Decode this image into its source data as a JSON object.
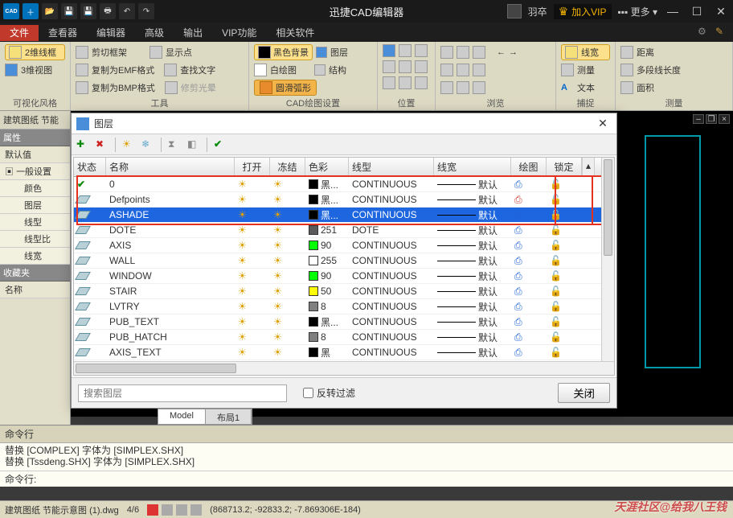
{
  "app": {
    "title": "迅捷CAD编辑器"
  },
  "titlebar": {
    "user_name": "羽卒",
    "vip_label": "加入VIP",
    "more_label": "更多"
  },
  "menubar": {
    "items": [
      "文件",
      "查看器",
      "编辑器",
      "高级",
      "输出",
      "VIP功能",
      "相关软件"
    ],
    "active_index": 0
  },
  "ribbon": {
    "group_visual": {
      "btn_2d": "2维线框",
      "btn_3d": "3维视图",
      "label": "可视化风格"
    },
    "group_tools": {
      "cut_frame": "剪切框架",
      "copy_emf": "复制为EMF格式",
      "copy_bmp": "复制为BMP格式",
      "show_point": "显示点",
      "find_text": "查找文字",
      "trim_light": "修剪光晕",
      "label": "工具"
    },
    "group_cad": {
      "black_bg": "黑色背景",
      "white_draw": "白绘图",
      "arc": "圆滑弧形",
      "layers": "图层",
      "structure": "结构",
      "label": "CAD绘图设置"
    },
    "group_position": {
      "label": "位置"
    },
    "group_browse": {
      "label": "浏览"
    },
    "group_measure": {
      "linewidth": "线宽",
      "measure": "测量",
      "text": "文本",
      "distance": "距离",
      "polyline_length": "多段线长度",
      "area": "面积",
      "ext": "捕捉",
      "label": "测量"
    }
  },
  "left_panel": {
    "tab1": "建筑图纸 节能",
    "prop_header": "属性",
    "default": "默认值",
    "general": "一般设置",
    "rows": [
      "颜色",
      "图层",
      "线型",
      "线型比",
      "线宽"
    ],
    "fav_header": "收藏夹",
    "name_header": "名称"
  },
  "dialog": {
    "title": "图层",
    "columns": {
      "state": "状态",
      "name": "名称",
      "open": "打开",
      "freeze": "冻结",
      "color": "色彩",
      "ltype": "线型",
      "lw": "线宽",
      "plot": "绘图",
      "lock": "锁定"
    },
    "layers": [
      {
        "name": "0",
        "current": true,
        "color_label": "黑...",
        "swatch": "#000000",
        "ltype": "CONTINUOUS",
        "lw": "默认",
        "plot": true,
        "selected": false
      },
      {
        "name": "Defpoints",
        "current": false,
        "color_label": "黑...",
        "swatch": "#000000",
        "ltype": "CONTINUOUS",
        "lw": "默认",
        "plot": false,
        "selected": false
      },
      {
        "name": "ASHADE",
        "current": false,
        "color_label": "黑...",
        "swatch": "#000000",
        "ltype": "CONTINUOUS",
        "lw": "默认",
        "plot": true,
        "selected": true
      },
      {
        "name": "DOTE",
        "current": false,
        "color_label": "251",
        "swatch": "#5b5b5b",
        "ltype": "DOTE",
        "lw": "默认",
        "plot": true,
        "selected": false
      },
      {
        "name": "AXIS",
        "current": false,
        "color_label": "90",
        "swatch": "#00ff00",
        "ltype": "CONTINUOUS",
        "lw": "默认",
        "plot": true,
        "selected": false
      },
      {
        "name": "WALL",
        "current": false,
        "color_label": "255",
        "swatch": "#ffffff",
        "ltype": "CONTINUOUS",
        "lw": "默认",
        "plot": true,
        "selected": false
      },
      {
        "name": "WINDOW",
        "current": false,
        "color_label": "90",
        "swatch": "#00ff00",
        "ltype": "CONTINUOUS",
        "lw": "默认",
        "plot": true,
        "selected": false
      },
      {
        "name": "STAIR",
        "current": false,
        "color_label": "50",
        "swatch": "#ffff00",
        "ltype": "CONTINUOUS",
        "lw": "默认",
        "plot": true,
        "selected": false
      },
      {
        "name": "LVTRY",
        "current": false,
        "color_label": "8",
        "swatch": "#808080",
        "ltype": "CONTINUOUS",
        "lw": "默认",
        "plot": true,
        "selected": false
      },
      {
        "name": "PUB_TEXT",
        "current": false,
        "color_label": "黑...",
        "swatch": "#000000",
        "ltype": "CONTINUOUS",
        "lw": "默认",
        "plot": true,
        "selected": false
      },
      {
        "name": "PUB_HATCH",
        "current": false,
        "color_label": "8",
        "swatch": "#808080",
        "ltype": "CONTINUOUS",
        "lw": "默认",
        "plot": true,
        "selected": false
      },
      {
        "name": "AXIS_TEXT",
        "current": false,
        "color_label": "黑",
        "swatch": "#000000",
        "ltype": "CONTINUOUS",
        "lw": "默认",
        "plot": true,
        "selected": false
      }
    ],
    "search_placeholder": "搜索图层",
    "invert_filter": "反转过滤",
    "close_btn": "关闭"
  },
  "model_tabs": {
    "model": "Model",
    "layout1": "布局1"
  },
  "command": {
    "title": "命令行",
    "line1": "替换 [COMPLEX] 字体为 [SIMPLEX.SHX]",
    "line2": "替换 [Tssdeng.SHX] 字体为 [SIMPLEX.SHX]",
    "prompt": "命令行:"
  },
  "statusbar": {
    "file": "建筑图纸 节能示意图 (1).dwg",
    "pages": "4/6",
    "coords": "(868713.2; -92833.2; -7.869306E-184)",
    "watermark": "天涯社区@给我八王钱"
  }
}
